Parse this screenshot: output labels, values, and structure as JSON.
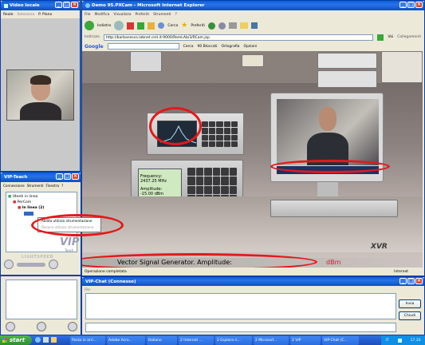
{
  "video_window": {
    "title": "Video locale",
    "toolbar": {
      "item1": "Reale",
      "item2": "Seleziona",
      "item3": "P. Piano"
    }
  },
  "ie_window": {
    "title": "Demo 95.PXCam - Microsoft Internet Explorer",
    "menu": [
      "File",
      "Modifica",
      "Visualizza",
      "Preferiti",
      "Strumenti",
      "?"
    ],
    "toolbar": {
      "back": "Indietro",
      "search": "Cerca",
      "favorites": "Preferiti"
    },
    "address_label": "Indirizzo",
    "address_value": "http://barbanesco.labnet.cnit.it:9000/RemLAb/3/RCam.jsp",
    "go": "Vai",
    "links": "Collegamenti",
    "google": {
      "logo": "Google",
      "search": "Cerca",
      "blocked": "90 Bloccati",
      "spell": "Ortografia",
      "options": "Opzioni"
    },
    "status": "Operazione completata",
    "zone": "Internet"
  },
  "scene": {
    "freq_label": "Frequency:",
    "freq_value": "2437.25 MHz",
    "amp_label": "Amplitude:",
    "amp_value": "-15.00 dBm",
    "caption": "Vector Signal Generator. Amplitude:",
    "unit": "dBm",
    "logo": "XVR"
  },
  "vip_window": {
    "title": "VIP-Teach",
    "menu": [
      "Connessione",
      "Strumenti",
      "Finestra",
      "?"
    ],
    "tree": {
      "root": "Utenti in linea",
      "group": "PerCom",
      "online": "In linea (2)",
      "ctx1": "Abilita utilizzo strumentazione",
      "ctx2": "Revoca utilizzo strumentazione"
    },
    "logo": "VIP",
    "logo_sub": "Teach",
    "brand": "LIGHTSPEED"
  },
  "chat_window": {
    "title": "VIP-Chat (Connesso)",
    "menu": "File",
    "send": "Invia",
    "close": "Chiudi"
  },
  "taskbar": {
    "start": "start",
    "items": [
      "Posta in arri...",
      "Adobe Acro...",
      "Italiano",
      "2 Internet ...",
      "2 Esplora ri...",
      "2 Microsof...",
      "2 VIP",
      "VIP-Chat (C..."
    ],
    "tray_lang": "IT",
    "clock": "17.33"
  },
  "colors": {
    "xp_blue": "#0a5fd8",
    "highlight_red": "#e3191b",
    "desktop": "#3a6ea5"
  }
}
